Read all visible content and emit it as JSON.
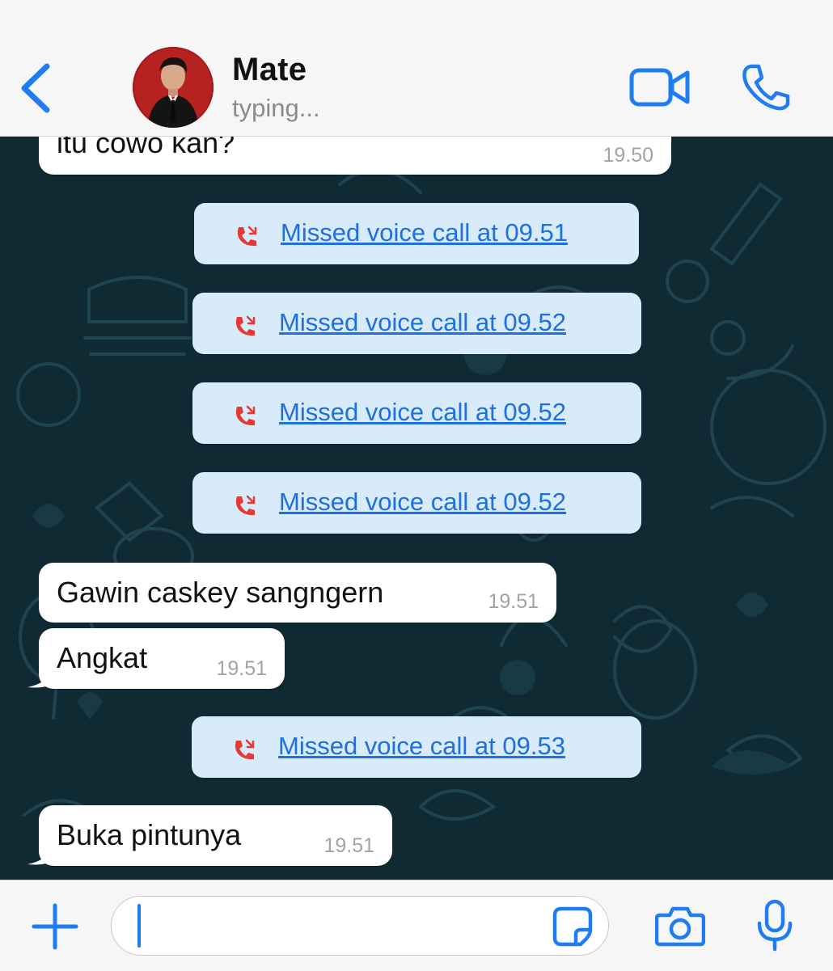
{
  "header": {
    "contact_name": "Mate",
    "status": "typing...",
    "icons": {
      "back": "chevron-left-icon",
      "video": "video-camera-icon",
      "call": "phone-icon"
    }
  },
  "messages": [
    {
      "type": "received",
      "text": "itu cowo kan?",
      "time": "19.50"
    },
    {
      "type": "missed-call",
      "text": "Missed voice call at 09.51"
    },
    {
      "type": "missed-call",
      "text": "Missed voice call at 09.52"
    },
    {
      "type": "missed-call",
      "text": "Missed voice call at 09.52"
    },
    {
      "type": "missed-call",
      "text": "Missed voice call at 09.52"
    },
    {
      "type": "received",
      "text": "Gawin caskey sangngern",
      "time": "19.51"
    },
    {
      "type": "received",
      "text": "Angkat",
      "time": "19.51"
    },
    {
      "type": "missed-call",
      "text": "Missed voice call at 09.53"
    },
    {
      "type": "received",
      "text": "Buka pintunya",
      "time": "19.51"
    }
  ],
  "input_bar": {
    "placeholder": "",
    "icons": {
      "add": "plus-icon",
      "sticker": "sticker-icon",
      "camera": "camera-icon",
      "mic": "microphone-icon"
    }
  },
  "colors": {
    "accent": "#1f7cf3",
    "missed_call_icon": "#e53935",
    "chat_background": "#0f2a33",
    "call_pill": "#d7ebfb"
  }
}
